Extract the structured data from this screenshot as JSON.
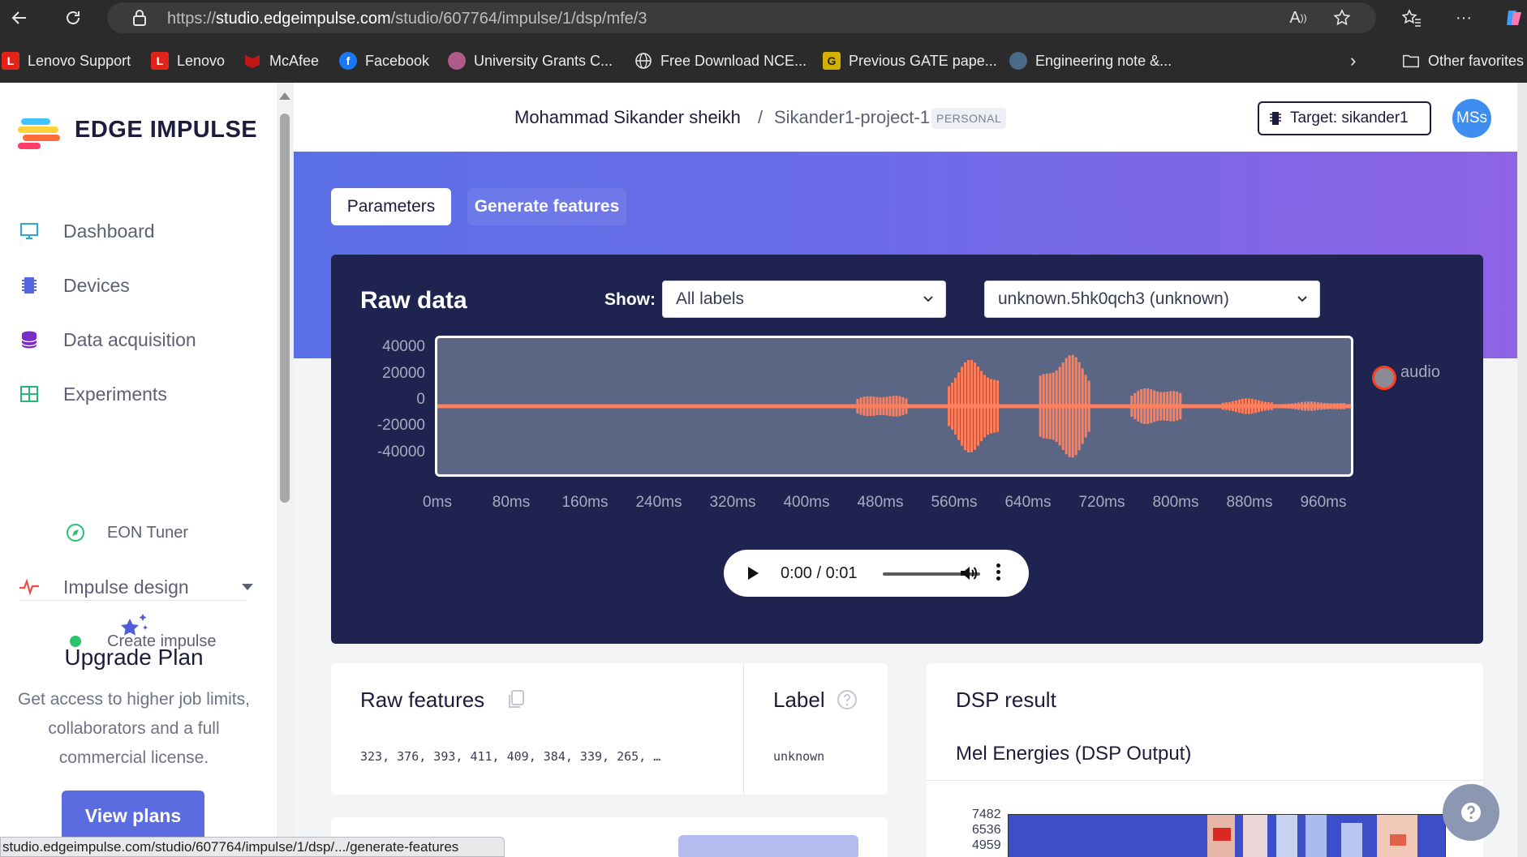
{
  "browser": {
    "url_host": "studio.edgeimpulse.com",
    "url_path": "/studio/607764/impulse/1/dsp/mfe/3",
    "url_scheme": "https://",
    "favorites": [
      {
        "label": "Lenovo Support",
        "icon": "lenovo-icon",
        "color": "#e2231a"
      },
      {
        "label": "Lenovo",
        "icon": "lenovo-icon",
        "color": "#e2231a"
      },
      {
        "label": "McAfee",
        "icon": "mcafee-icon",
        "color": "#c01818"
      },
      {
        "label": "Facebook",
        "icon": "facebook-icon",
        "color": "#1877f2"
      },
      {
        "label": "University Grants C...",
        "icon": "ugc-icon",
        "color": "#b05a8a"
      },
      {
        "label": "Free Download NCE...",
        "icon": "globe-icon",
        "color": "#ffffff"
      },
      {
        "label": "Previous GATE pape...",
        "icon": "gate-icon",
        "color": "#d4b000"
      },
      {
        "label": "Engineering note &...",
        "icon": "engineering-icon",
        "color": "#4a6a8a"
      }
    ],
    "other_favorites": "Other favorites"
  },
  "sidebar": {
    "brand": "EDGE IMPULSE",
    "items": [
      {
        "label": "Dashboard",
        "icon": "monitor-icon"
      },
      {
        "label": "Devices",
        "icon": "chip-icon"
      },
      {
        "label": "Data acquisition",
        "icon": "database-icon"
      },
      {
        "label": "Experiments",
        "icon": "grid-icon"
      },
      {
        "label": "EON Tuner",
        "icon": "compass-icon"
      },
      {
        "label": "Impulse design",
        "icon": "pulse-icon"
      },
      {
        "label": "Create impulse",
        "icon": "dot-icon"
      }
    ],
    "upgrade": {
      "title": "Upgrade Plan",
      "text": "Get access to higher job limits, collaborators and a full commercial license.",
      "button": "View plans"
    },
    "status_url": "studio.edgeimpulse.com/studio/607764/impulse/1/dsp/.../generate-features"
  },
  "header": {
    "user": "Mohammad Sikander sheikh",
    "separator": "/",
    "project": "Sikander1-project-1",
    "badge": "PERSONAL",
    "target": "Target: sikander1",
    "avatar": "MSs"
  },
  "tabs": {
    "parameters": "Parameters",
    "generate": "Generate features"
  },
  "raw_data": {
    "title": "Raw data",
    "show_label": "Show:",
    "filter_value": "All labels",
    "sample_value": "unknown.5hk0qch3 (unknown)",
    "legend": "audio",
    "y_ticks": [
      "40000",
      "20000",
      "0",
      "-20000",
      "-40000"
    ],
    "x_ticks": [
      "0ms",
      "80ms",
      "160ms",
      "240ms",
      "320ms",
      "400ms",
      "480ms",
      "560ms",
      "640ms",
      "720ms",
      "800ms",
      "880ms",
      "960ms"
    ],
    "audio_time": "0:00 / 0:01",
    "bursts": [
      {
        "start_ms": 460,
        "end_ms": 515,
        "amplitude": 8000
      },
      {
        "start_ms": 560,
        "end_ms": 615,
        "amplitude": 30000
      },
      {
        "start_ms": 660,
        "end_ms": 715,
        "amplitude": 34000
      },
      {
        "start_ms": 760,
        "end_ms": 815,
        "amplitude": 13000
      },
      {
        "start_ms": 860,
        "end_ms": 915,
        "amplitude": 5000
      },
      {
        "start_ms": 925,
        "end_ms": 995,
        "amplitude": 3000
      }
    ],
    "colors": {
      "wave": "#ff7f5c",
      "plot_bg": "#5b6584",
      "card_bg": "#1e2350"
    }
  },
  "raw_features": {
    "title": "Raw features",
    "values": "323, 376, 393, 411, 409, 384, 339, 265, …"
  },
  "label": {
    "title": "Label",
    "value": "unknown"
  },
  "dsp": {
    "title": "DSP result",
    "subtitle": "Mel Energies (DSP Output)",
    "y_ticks": [
      "7482",
      "6536",
      "4959"
    ]
  }
}
